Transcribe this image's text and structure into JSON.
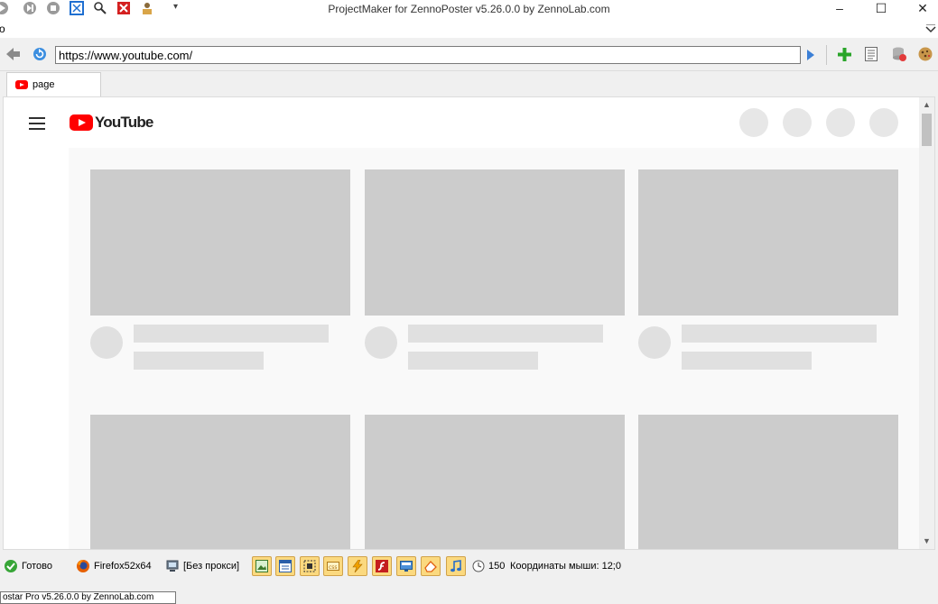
{
  "window": {
    "title": "ProjectMaker for ZennoPoster v5.26.0.0 by ZennoLab.com",
    "menu_glyph": "o"
  },
  "address_bar": {
    "url": "https://www.youtube.com/"
  },
  "tabs": [
    {
      "label": "page",
      "icon": "youtube-icon"
    }
  ],
  "page": {
    "logo_text": "YouTube",
    "brand_color": "#ff0000"
  },
  "status": {
    "ready": "Готово",
    "browser": "Firefox52x64",
    "proxy": "[Без прокси]",
    "counter": "150",
    "mouse_coords": "Координаты мыши: 12;0"
  },
  "taskbar_tip": "ostar Pro v5.26.0.0 by ZennoLab.com",
  "colors": {
    "accent": "#1a73e8",
    "toolbar_highlight": "#fbd97f",
    "skeleton_thumb": "#cccccc",
    "skeleton_line": "#e0e0e0"
  }
}
